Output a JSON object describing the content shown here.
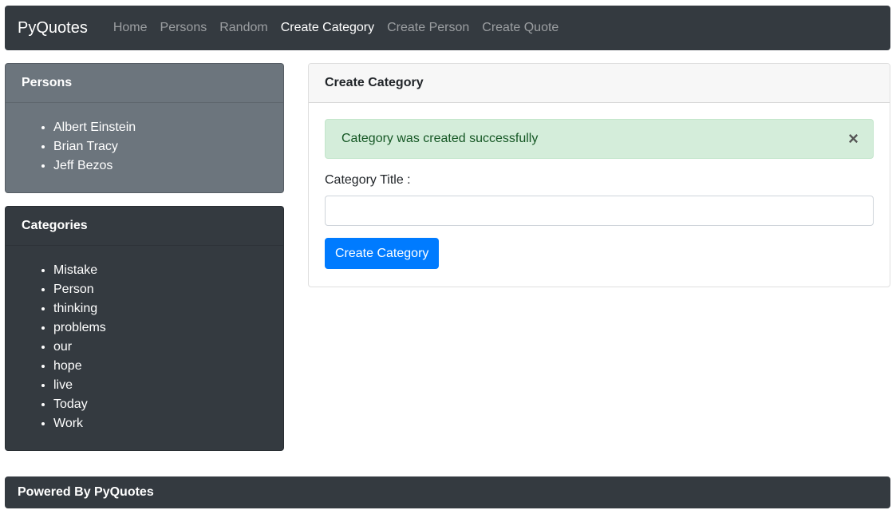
{
  "navbar": {
    "brand": "PyQuotes",
    "links": [
      {
        "label": "Home",
        "active": false
      },
      {
        "label": "Persons",
        "active": false
      },
      {
        "label": "Random",
        "active": false
      },
      {
        "label": "Create Category",
        "active": true
      },
      {
        "label": "Create Person",
        "active": false
      },
      {
        "label": "Create Quote",
        "active": false
      }
    ]
  },
  "sidebar": {
    "persons": {
      "title": "Persons",
      "items": [
        "Albert Einstein",
        "Brian Tracy",
        "Jeff Bezos"
      ]
    },
    "categories": {
      "title": "Categories",
      "items": [
        "Mistake",
        "Person",
        "thinking",
        "problems",
        "our",
        "hope",
        "live",
        "Today",
        "Work"
      ]
    }
  },
  "main": {
    "title": "Create Category",
    "alert": {
      "message": "Category was created successfully",
      "close_symbol": "×"
    },
    "form": {
      "label": "Category Title :",
      "value": "",
      "placeholder": "",
      "submit_label": "Create Category"
    }
  },
  "footer": {
    "text": "Powered By PyQuotes"
  },
  "colors": {
    "navbar_bg": "#343a40",
    "persons_bg": "#6c757d",
    "alert_bg": "#d4edda",
    "alert_text": "#155724",
    "primary": "#007bff"
  }
}
